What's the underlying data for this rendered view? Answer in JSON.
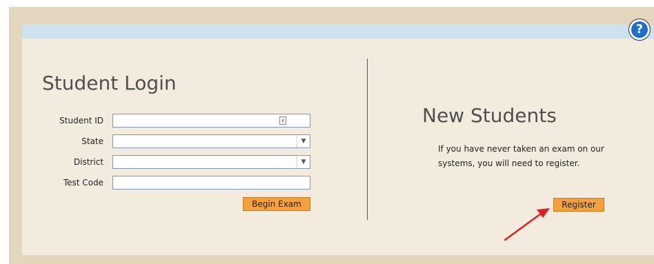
{
  "help": {
    "label": "?"
  },
  "login": {
    "title": "Student Login",
    "fields": [
      {
        "label": "Student ID",
        "value": "",
        "type": "text"
      },
      {
        "label": "State",
        "value": "",
        "type": "select"
      },
      {
        "label": "District",
        "value": "",
        "type": "select"
      },
      {
        "label": "Test Code",
        "value": "",
        "type": "text"
      }
    ],
    "submit_label": "Begin Exam"
  },
  "new_students": {
    "title": "New Students",
    "description": "If you have never taken an exam on our systems, you will need to register.",
    "register_label": "Register"
  },
  "colors": {
    "frame": "#e3d6bf",
    "panel": "#f3ebde",
    "header_band": "#cfe0ef",
    "button": "#f2a13c",
    "annotation_arrow": "#e02020",
    "help_icon": "#1e6fc7"
  },
  "icons": {
    "help": "question-circle-icon",
    "student_id": "id-card-icon",
    "dropdown": "chevron-down-icon",
    "annotation": "red-arrow-icon"
  }
}
